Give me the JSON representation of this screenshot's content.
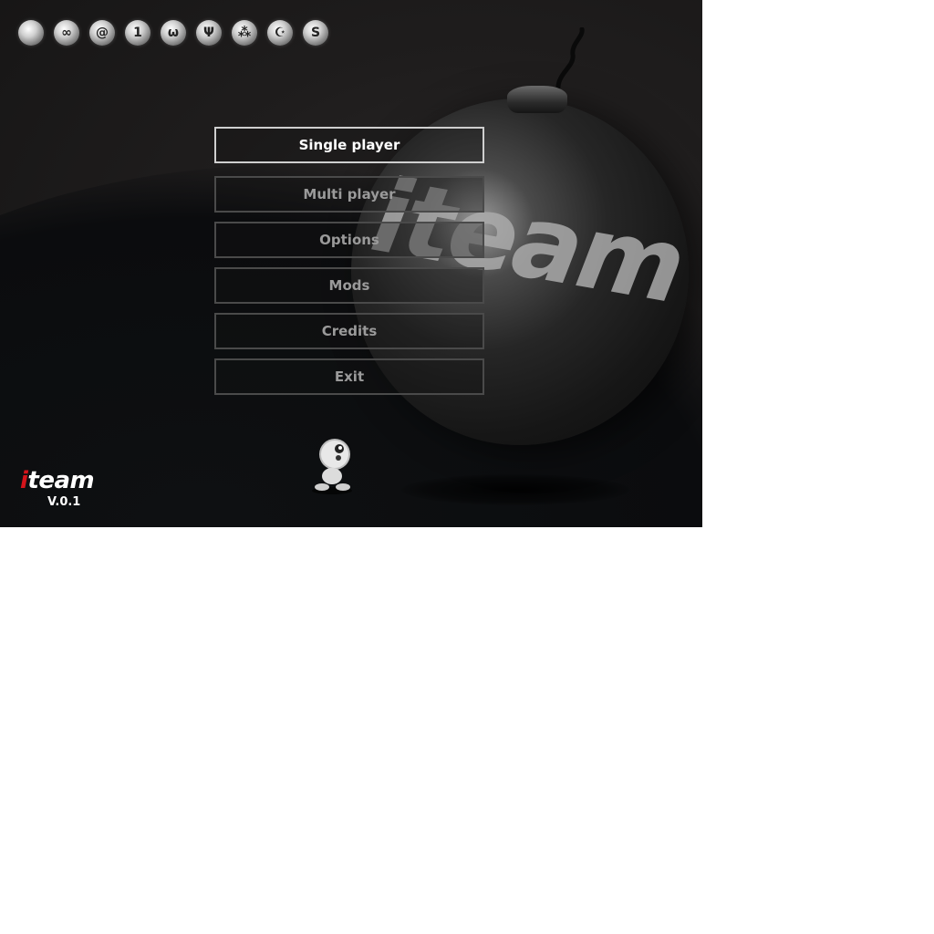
{
  "top_icons": [
    {
      "icon": "crescent-swirl-icon",
      "glyph": ""
    },
    {
      "icon": "infinity-icon",
      "glyph": "∞"
    },
    {
      "icon": "spiral-icon",
      "glyph": "@"
    },
    {
      "icon": "number-one-icon",
      "glyph": "1"
    },
    {
      "icon": "mustache-icon",
      "glyph": "ω"
    },
    {
      "icon": "trident-icon",
      "glyph": "Ψ"
    },
    {
      "icon": "triple-dots-icon",
      "glyph": "⁂"
    },
    {
      "icon": "crescent-star-icon",
      "glyph": "☪"
    },
    {
      "icon": "letter-s-icon",
      "glyph": "S"
    }
  ],
  "bomb": {
    "brand_text": "iteam"
  },
  "menu": {
    "selected_index": 0,
    "items": [
      {
        "label": "Single player"
      },
      {
        "label": "Multi player"
      },
      {
        "label": "Options"
      },
      {
        "label": "Mods"
      },
      {
        "label": "Credits"
      },
      {
        "label": "Exit"
      }
    ]
  },
  "logo": {
    "prefix": "i",
    "rest": "team"
  },
  "version": "V.0.1",
  "colors": {
    "logo_accent": "#d4141b",
    "selected_border": "#cfcfcf",
    "button_border": "#4a4a4a"
  }
}
